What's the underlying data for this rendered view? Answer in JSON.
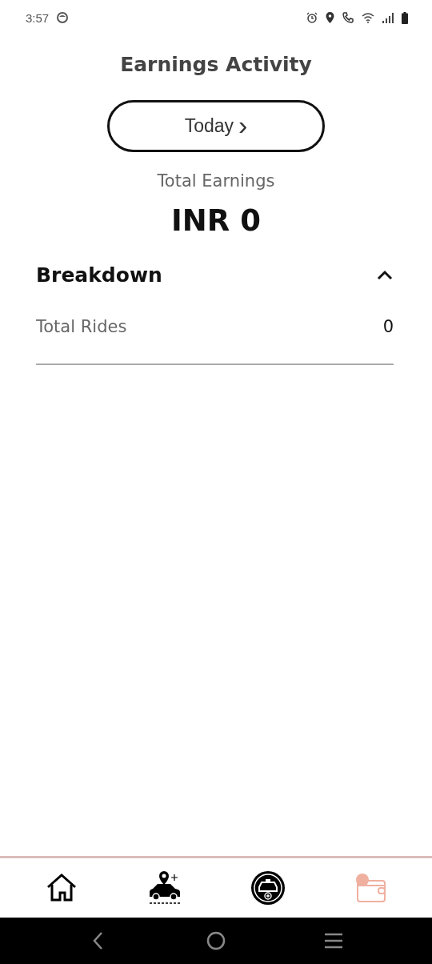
{
  "status_bar": {
    "time": "3:57"
  },
  "title": "Earnings Activity",
  "period_button": {
    "label": "Today",
    "arrow": "›"
  },
  "total": {
    "label": "Total Earnings",
    "value": "INR 0"
  },
  "breakdown": {
    "title": "Breakdown",
    "expanded": true,
    "rows": [
      {
        "label": "Total Rides",
        "value": "0"
      }
    ]
  },
  "tabs": [
    {
      "kind": "home",
      "selected": false
    },
    {
      "kind": "car-location",
      "selected": false
    },
    {
      "kind": "taxi-add",
      "selected": false
    },
    {
      "kind": "wallet",
      "selected": true
    }
  ]
}
